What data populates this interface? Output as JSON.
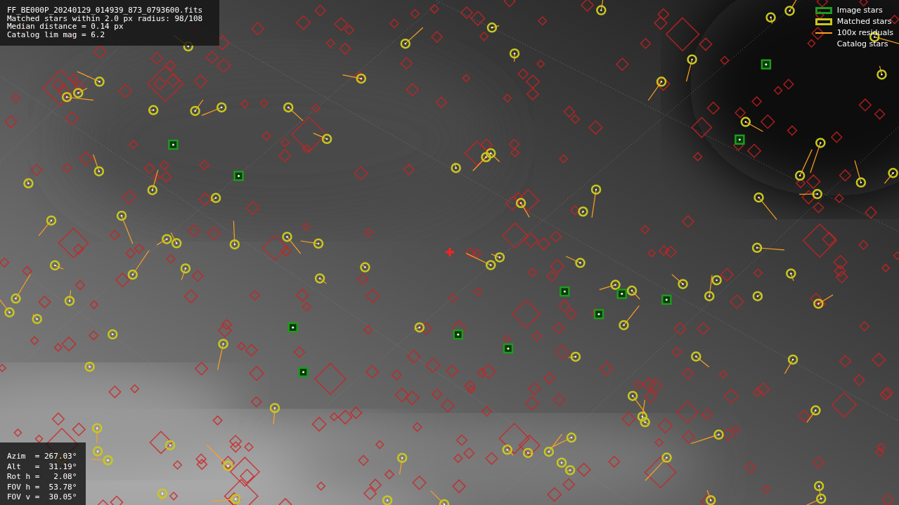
{
  "file_info": {
    "lines": [
      "FF_BE000P_20240129_014939_873_0793600.fits",
      "Matched stars within 2.0 px radius: 98/108",
      "Median distance = 0.14 px",
      "Catalog lim mag = 6.2"
    ]
  },
  "legend": [
    {
      "label": "Image stars",
      "kind": "box",
      "color": "#1e9a1e"
    },
    {
      "label": "Matched stars",
      "kind": "box",
      "color": "#c8c81e"
    },
    {
      "label": "100x residuals",
      "kind": "line",
      "color": "#ffa020"
    },
    {
      "label": "Catalog stars",
      "kind": "none"
    }
  ],
  "pointing": {
    "lines": [
      "Azim  = 267.03°",
      "Alt   =  31.19°",
      "Rot h =   2.08°",
      "FOV h =  53.78°",
      "FOV v =  30.05°"
    ]
  }
}
